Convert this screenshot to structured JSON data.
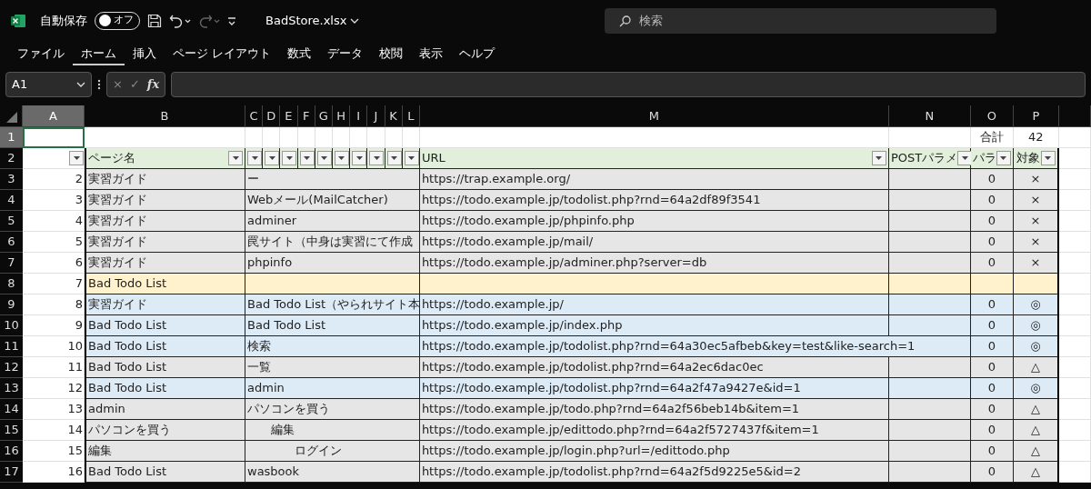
{
  "titlebar": {
    "autosave_label": "自動保存",
    "autosave": {
      "on": false,
      "label": "オフ"
    },
    "filename": "BadStore.xlsx",
    "search": {
      "placeholder": "検索"
    }
  },
  "ribbon_tabs": [
    {
      "label": "ファイル",
      "selected": false
    },
    {
      "label": "ホーム",
      "selected": true
    },
    {
      "label": "挿入",
      "selected": false
    },
    {
      "label": "ページ レイアウト",
      "selected": false
    },
    {
      "label": "数式",
      "selected": false
    },
    {
      "label": "データ",
      "selected": false
    },
    {
      "label": "校閲",
      "selected": false
    },
    {
      "label": "表示",
      "selected": false
    },
    {
      "label": "ヘルプ",
      "selected": false
    }
  ],
  "formula_bar": {
    "name_box": "A1",
    "cancel": "×",
    "enter": "✓",
    "function": "fx"
  },
  "columns": [
    {
      "label": "A",
      "selected": true
    },
    {
      "label": "B",
      "selected": false
    },
    {
      "label": "C",
      "selected": false
    },
    {
      "label": "D",
      "selected": false
    },
    {
      "label": "E",
      "selected": false
    },
    {
      "label": "F",
      "selected": false
    },
    {
      "label": "G",
      "selected": false
    },
    {
      "label": "H",
      "selected": false
    },
    {
      "label": "I",
      "selected": false
    },
    {
      "label": "J",
      "selected": false
    },
    {
      "label": "K",
      "selected": false
    },
    {
      "label": "L",
      "selected": false
    },
    {
      "label": "M",
      "selected": false
    },
    {
      "label": "N",
      "selected": false
    },
    {
      "label": "O",
      "selected": false
    },
    {
      "label": "P",
      "selected": false
    }
  ],
  "row_1": {
    "row_number": "1",
    "selected": true,
    "total_label": "合計",
    "total": "42"
  },
  "header_row": {
    "row_number": "2",
    "page_name": "ページ名",
    "url": "URL",
    "post_params": "POSTパラメ",
    "params": "パラ",
    "target": "対象"
  },
  "rows": [
    {
      "row_number": "3",
      "no": "2",
      "page_name": "実習ガイド",
      "title": "ー",
      "url": "https://trap.example.org/",
      "params": "0",
      "target": "×",
      "color": "#e7e6e6"
    },
    {
      "row_number": "4",
      "no": "3",
      "page_name": "実習ガイド",
      "title": "Webメール(MailCatcher)",
      "url": "https://todo.example.jp/todolist.php?rnd=64a2df89f3541",
      "params": "0",
      "target": "×",
      "color": "#e7e6e6"
    },
    {
      "row_number": "5",
      "no": "4",
      "page_name": "実習ガイド",
      "title": "adminer",
      "url": "https://todo.example.jp/phpinfo.php",
      "params": "0",
      "target": "×",
      "color": "#e7e6e6"
    },
    {
      "row_number": "6",
      "no": "5",
      "page_name": "実習ガイド",
      "title": "罠サイト（中身は実習にて作成",
      "url": "https://todo.example.jp/mail/",
      "params": "0",
      "target": "×",
      "color": "#e7e6e6"
    },
    {
      "row_number": "7",
      "no": "6",
      "page_name": "実習ガイド",
      "title": "phpinfo",
      "url": "https://todo.example.jp/adminer.php?server=db",
      "params": "0",
      "target": "×",
      "color": "#e7e6e6"
    },
    {
      "row_number": "8",
      "no": "7",
      "page_name": "Bad Todo List",
      "color": "#fff2cc"
    },
    {
      "row_number": "9",
      "no": "8",
      "page_name": "実習ガイド",
      "title": "Bad Todo List（やられサイト本",
      "url": "https://todo.example.jp/",
      "params": "0",
      "target": "◎",
      "color": "#ddebf7"
    },
    {
      "row_number": "10",
      "no": "9",
      "page_name": "Bad Todo List",
      "title": "Bad Todo List",
      "url": "https://todo.example.jp/index.php",
      "params": "0",
      "target": "◎",
      "color": "#ddebf7"
    },
    {
      "row_number": "11",
      "no": "10",
      "page_name": "Bad Todo List",
      "title": "検索",
      "url": "https://todo.example.jp/todolist.php?rnd=64a30ec5afbeb&key=test&like-search=1",
      "params": "0",
      "target": "◎",
      "color": "#ddebf7"
    },
    {
      "row_number": "12",
      "no": "11",
      "page_name": "Bad Todo List",
      "title": "一覧",
      "url": "https://todo.example.jp/todolist.php?rnd=64a2ec6dac0ec",
      "params": "0",
      "target": "△",
      "color": "#e7e6e6"
    },
    {
      "row_number": "13",
      "no": "12",
      "page_name": "Bad Todo List",
      "title": "admin",
      "url": "https://todo.example.jp/todolist.php?rnd=64a2f47a9427e&id=1",
      "params": "0",
      "target": "◎",
      "color": "#ddebf7"
    },
    {
      "row_number": "14",
      "no": "13",
      "page_name": "admin",
      "title": "パソコンを買う",
      "url": "https://todo.example.jp/todo.php?rnd=64a2f56beb14b&item=1",
      "params": "0",
      "target": "△",
      "color": "#e7e6e6"
    },
    {
      "row_number": "15",
      "no": "14",
      "page_name": "パソコンを買う",
      "title": "　　編集",
      "url": "https://todo.example.jp/edittodo.php?rnd=64a2f5727437f&item=1",
      "params": "0",
      "target": "△",
      "color": "#e7e6e6"
    },
    {
      "row_number": "16",
      "no": "15",
      "page_name": "編集",
      "title": "　　　　ログイン",
      "url": "https://todo.example.jp/login.php?url=/edittodo.php",
      "params": "0",
      "target": "△",
      "color": "#e7e6e6"
    },
    {
      "row_number": "17",
      "no": "16",
      "page_name": "Bad Todo List",
      "title": "wasbook",
      "url": "https://todo.example.jp/todolist.php?rnd=64a2f5d9225e5&id=2",
      "params": "0",
      "target": "△",
      "color": "#e7e6e6"
    }
  ]
}
